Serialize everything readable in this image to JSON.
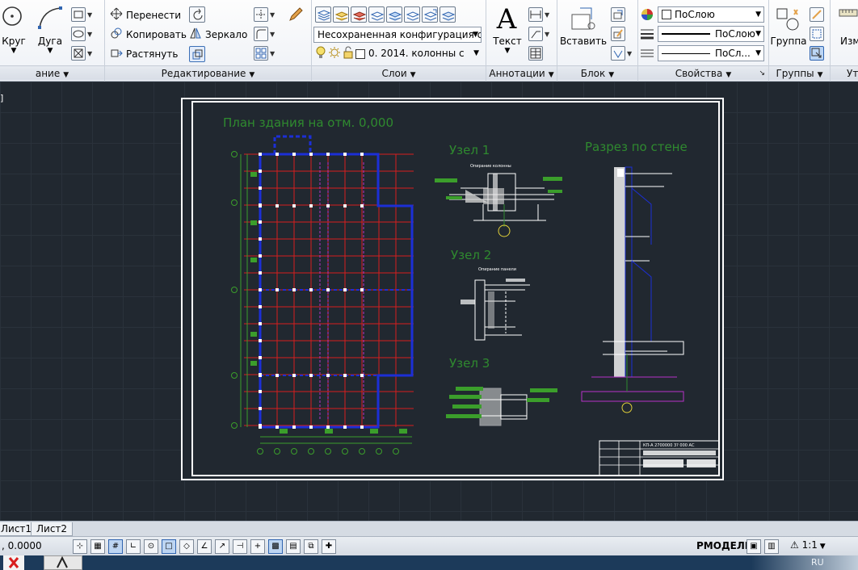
{
  "ribbon": {
    "draw": {
      "circle_label": "Круг",
      "arc_label": "Дуга",
      "panel_title": "ание"
    },
    "modify": {
      "move_label": "Перенести",
      "copy_label": "Копировать",
      "stretch_label": "Растянуть",
      "mirror_label": "Зеркало",
      "panel_title": "Редактирование"
    },
    "layers": {
      "layer_state_value": "Несохраненная конфигурация сло",
      "current_layer_value": "0. 2014.  колонны с",
      "panel_title": "Слои"
    },
    "annotation": {
      "text_label": "Текст",
      "panel_title": "Аннотации"
    },
    "block": {
      "insert_label": "Вставить",
      "panel_title": "Блок"
    },
    "properties": {
      "color_value": "ПоСлою",
      "lineweight_value": "ПоСлою",
      "linetype_value": "ПоСл...",
      "panel_title": "Свойства"
    },
    "groups": {
      "group_label": "Группа",
      "panel_title": "Группы"
    },
    "utilities": {
      "measure_label": "Изм",
      "panel_title": "Ут"
    }
  },
  "canvas": {
    "corner_tag": "]"
  },
  "drawing": {
    "plan_title": "План здания на отм. 0,000",
    "node1_title": "Узел 1",
    "node1_caption": "Опирание колонны",
    "node2_title": "Узел 2",
    "node2_caption": "Опирание панели",
    "node3_title": "Узел 3",
    "section_title": "Разрез по стене",
    "stamp_code": "КП-А 2700000 3? 000 АС"
  },
  "tabs": [
    {
      "label": "Лист1"
    },
    {
      "label": "Лист2"
    }
  ],
  "status": {
    "coords": ", 0.0000",
    "space": "РМОДЕЛЬ",
    "scale": "1:1"
  },
  "taskbar": {
    "language": "RU"
  },
  "colors": {
    "canvas_bg": "#212830",
    "grid_red": "#d81e1e",
    "wall_blue": "#1c2fd6",
    "title_green": "#2f8a2f",
    "annot_green": "#3b9e2b",
    "magenta": "#b632c8"
  }
}
